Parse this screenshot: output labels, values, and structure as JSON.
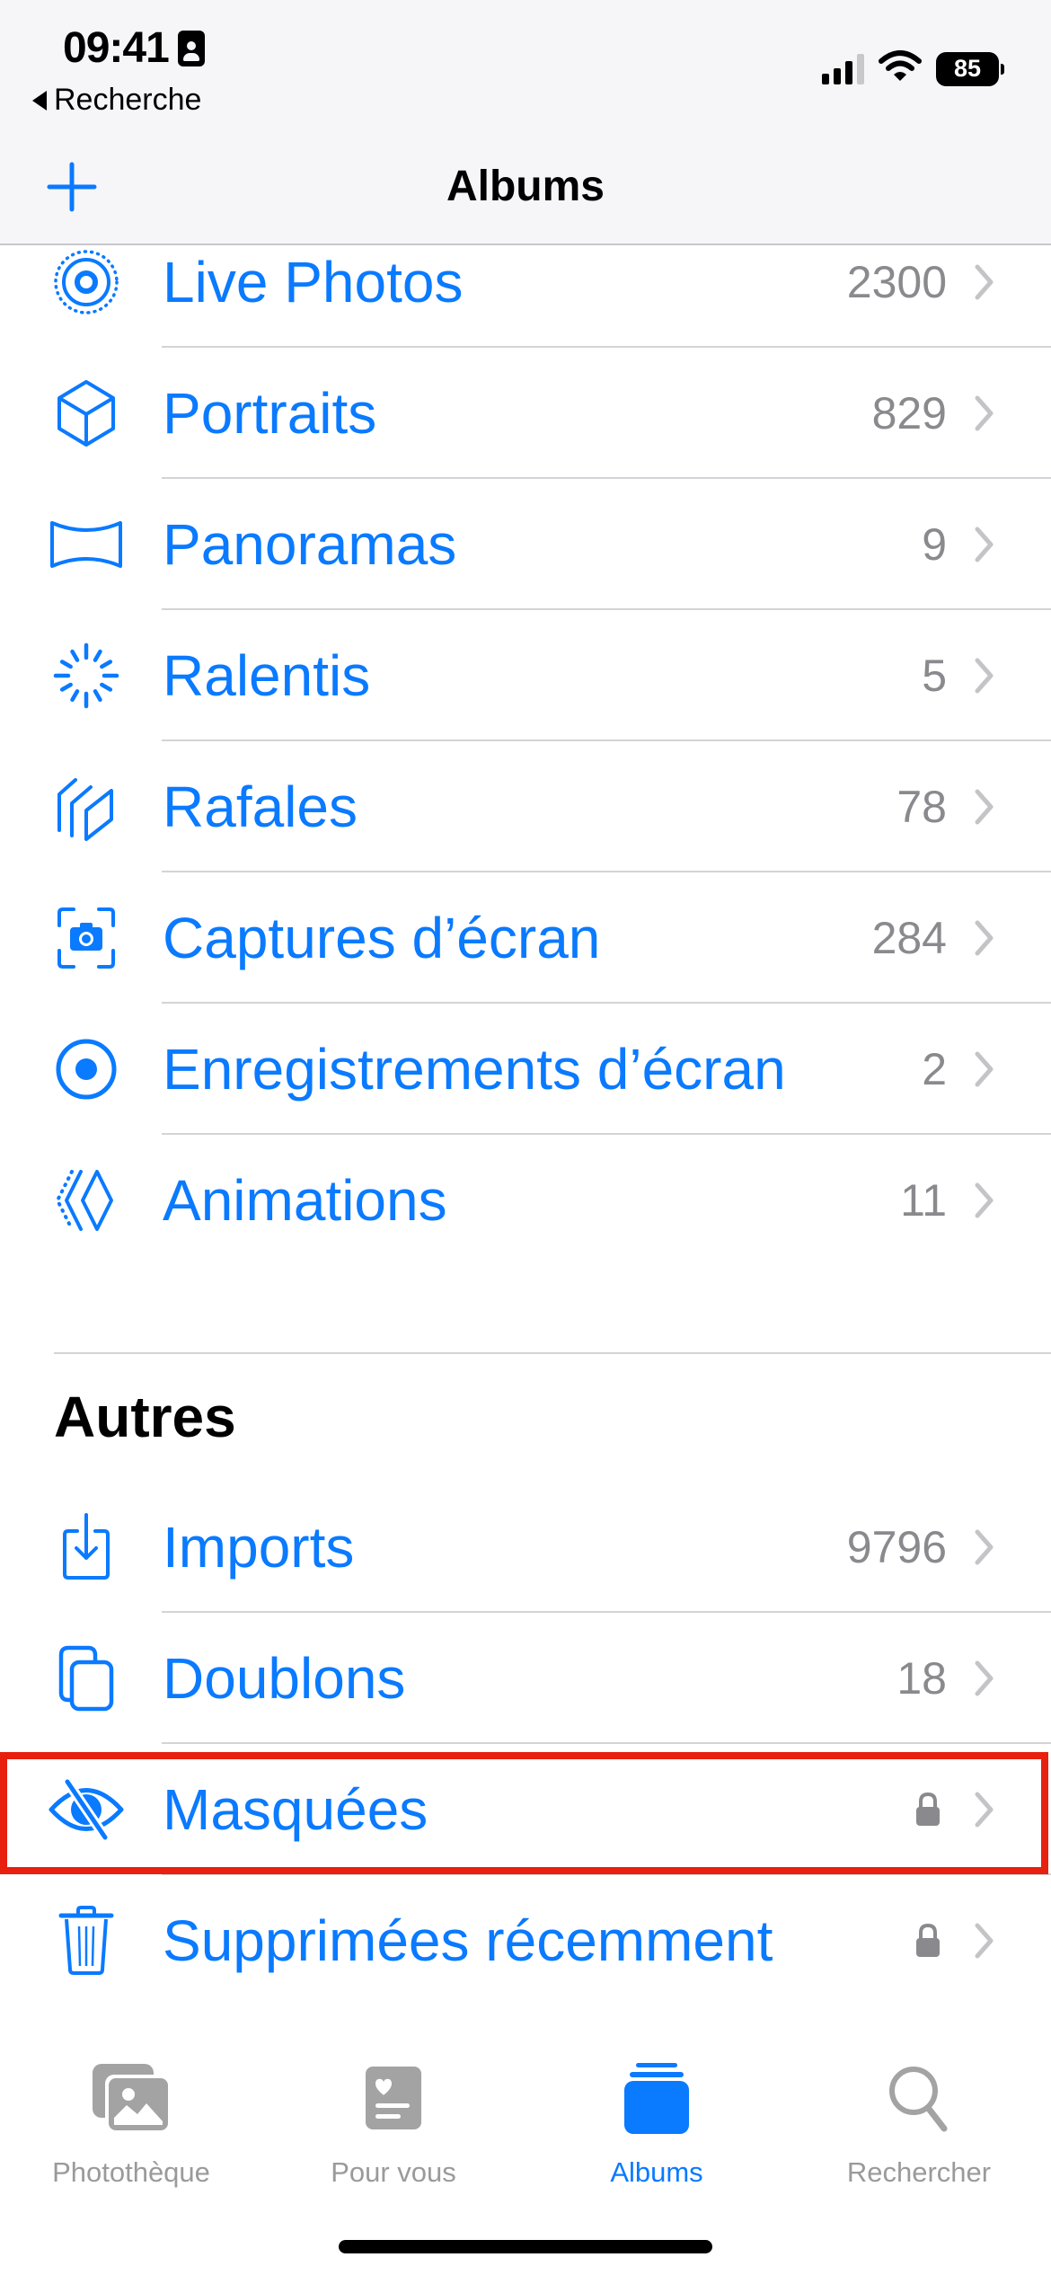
{
  "status_bar": {
    "time": "09:41",
    "back_label": "Recherche",
    "battery": "85",
    "signal_bars_active": 3,
    "signal_bars_total": 4
  },
  "nav": {
    "title": "Albums",
    "add_icon": "plus-icon"
  },
  "media_types": [
    {
      "label": "Live Photos",
      "count": "2300",
      "icon": "live-photo-icon"
    },
    {
      "label": "Portraits",
      "count": "829",
      "icon": "cube-icon"
    },
    {
      "label": "Panoramas",
      "count": "9",
      "icon": "panorama-icon"
    },
    {
      "label": "Ralentis",
      "count": "5",
      "icon": "slowmo-icon"
    },
    {
      "label": "Rafales",
      "count": "78",
      "icon": "burst-icon"
    },
    {
      "label": "Captures d’écran",
      "count": "284",
      "icon": "screenshot-icon"
    },
    {
      "label": "Enregistrements d’écran",
      "count": "2",
      "icon": "screen-record-icon"
    },
    {
      "label": "Animations",
      "count": "11",
      "icon": "animation-icon"
    }
  ],
  "others": {
    "title": "Autres",
    "items": [
      {
        "label": "Imports",
        "count": "9796",
        "icon": "import-icon",
        "locked": false
      },
      {
        "label": "Doublons",
        "count": "18",
        "icon": "duplicate-icon",
        "locked": false
      },
      {
        "label": "Masquées",
        "count": "",
        "icon": "eye-slash-icon",
        "locked": true,
        "highlighted": true
      },
      {
        "label": "Supprimées récemment",
        "count": "",
        "icon": "trash-icon",
        "locked": true
      }
    ]
  },
  "tabbar": {
    "tabs": [
      {
        "label": "Photothèque",
        "icon": "photo-library-icon",
        "active": false
      },
      {
        "label": "Pour vous",
        "icon": "for-you-icon",
        "active": false
      },
      {
        "label": "Albums",
        "icon": "albums-icon",
        "active": true
      },
      {
        "label": "Rechercher",
        "icon": "search-icon",
        "active": false
      }
    ]
  },
  "colors": {
    "accent": "#0a7aff",
    "secondary_text": "#8a8a8e",
    "highlight_border": "#e8200f",
    "inactive_tab": "#9a9a9a"
  }
}
